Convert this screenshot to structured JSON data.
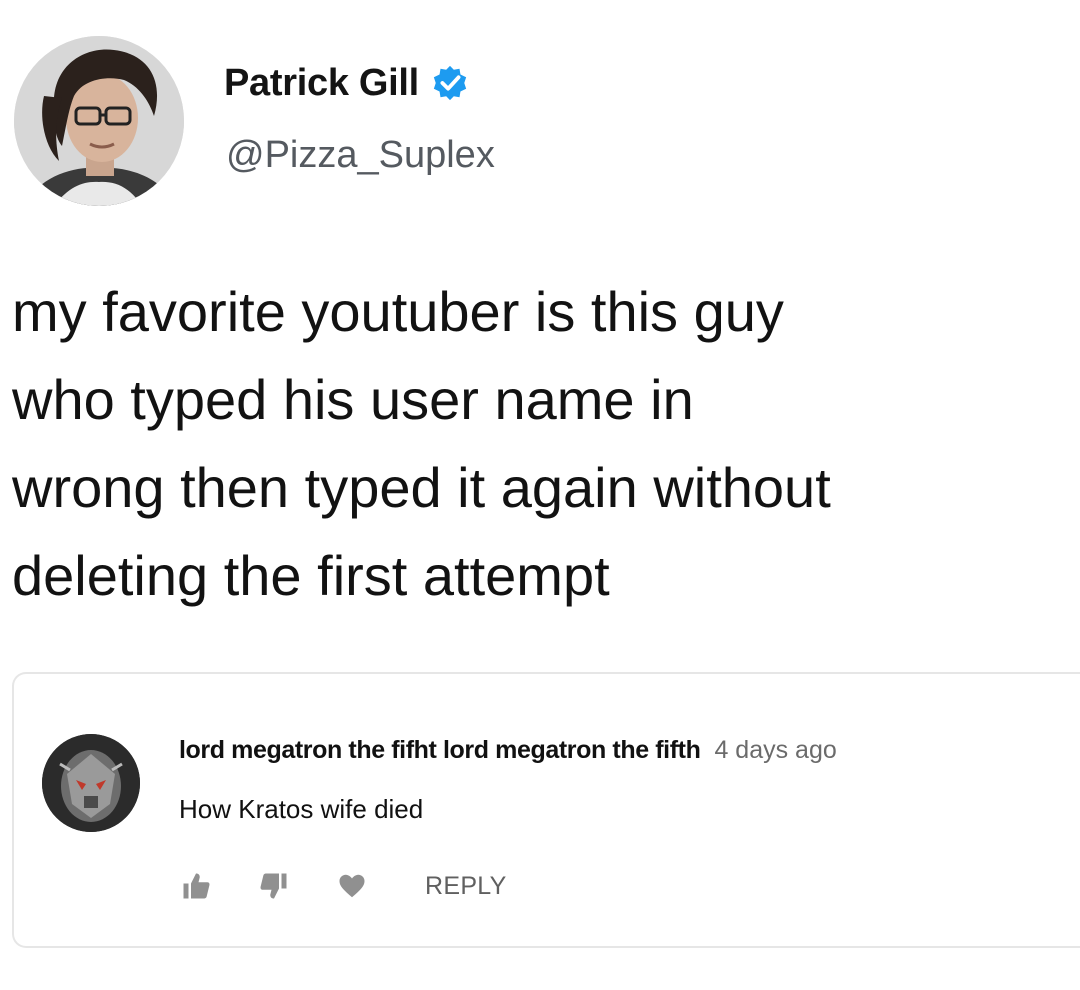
{
  "tweet": {
    "author": {
      "name": "Patrick Gill",
      "handle": "@Pizza_Suplex",
      "verified_icon": "verified-badge-icon",
      "accent_color": "#1d9bf0"
    },
    "text_lines": [
      "my favorite youtuber is this guy",
      "who typed his user name in",
      "wrong then typed it again without",
      "deleting the first attempt"
    ]
  },
  "comment": {
    "author": "lord megatron the fifht lord megatron the fifth",
    "time": "4 days ago",
    "text": "How Kratos wife died",
    "actions": {
      "like_icon": "thumbs-up-icon",
      "dislike_icon": "thumbs-down-icon",
      "heart_icon": "heart-icon",
      "reply_label": "REPLY"
    }
  }
}
